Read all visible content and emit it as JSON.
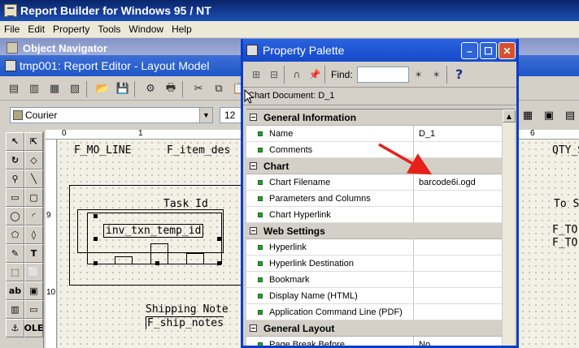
{
  "app": {
    "title": "Report Builder for Windows 95 / NT",
    "menu": [
      "File",
      "Edit",
      "Property",
      "Tools",
      "Window",
      "Help"
    ]
  },
  "object_navigator": {
    "title": "Object Navigator"
  },
  "editor": {
    "title": "tmp001: Report Editor - Layout Model",
    "font_name": "Courier",
    "font_size": "12",
    "ruler_top": [
      "0",
      "1",
      "6"
    ],
    "ruler_left": [
      "9",
      "10"
    ],
    "fields": {
      "mo_line": "F_MO_LINE",
      "item_des": "F_item_des",
      "qty_shi": "QTY_SHI",
      "task_id": "Task Id",
      "inv_txn": "inv_txn_temp_id",
      "to_s": "To S",
      "f_to_1": "F_TO",
      "f_to_2": "F_TO",
      "shipping_note": "Shipping Note",
      "ship_notes": "F_ship_notes"
    }
  },
  "property_palette": {
    "title": "Property Palette",
    "find_label": "Find:",
    "find_value": "",
    "document_label": "Chart Document: D_1",
    "sections": [
      {
        "label": "General Information",
        "rows": [
          {
            "name": "Name",
            "value": "D_1"
          },
          {
            "name": "Comments",
            "value": ""
          }
        ]
      },
      {
        "label": "Chart",
        "rows": [
          {
            "name": "Chart Filename",
            "value": "barcode6i.ogd"
          },
          {
            "name": "Parameters and Columns",
            "value": ""
          },
          {
            "name": "Chart Hyperlink",
            "value": ""
          }
        ]
      },
      {
        "label": "Web Settings",
        "rows": [
          {
            "name": "Hyperlink",
            "value": ""
          },
          {
            "name": "Hyperlink Destination",
            "value": ""
          },
          {
            "name": "Bookmark",
            "value": ""
          },
          {
            "name": "Display Name (HTML)",
            "value": ""
          },
          {
            "name": "Application Command Line (PDF)",
            "value": ""
          }
        ]
      },
      {
        "label": "General Layout",
        "rows": [
          {
            "name": "Page Break Before",
            "value": "No"
          }
        ]
      }
    ]
  },
  "colors": {
    "titlebar": "#1549c9",
    "annotation_arrow": "#e8201a",
    "property_bullet": "#2e9a32"
  }
}
